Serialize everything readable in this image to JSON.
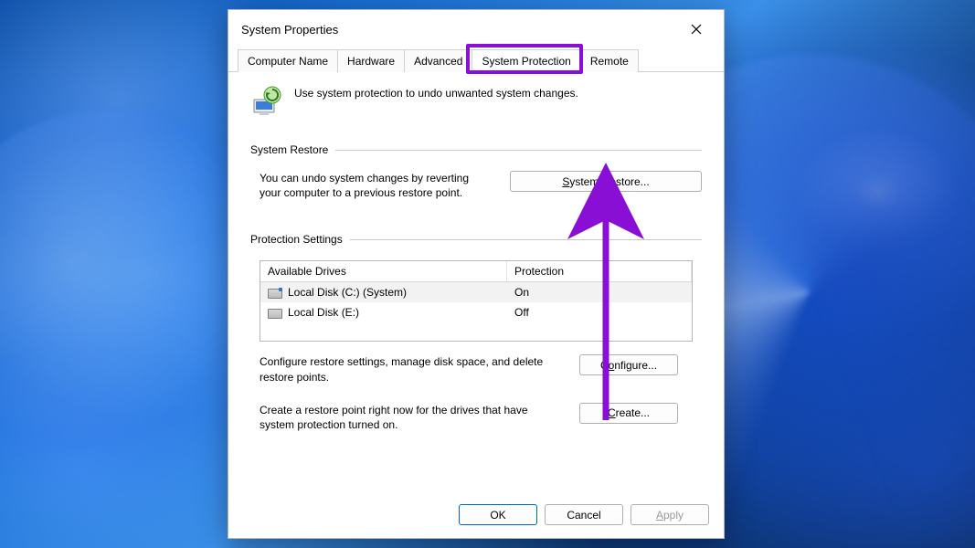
{
  "window": {
    "title": "System Properties"
  },
  "tabs": {
    "items": [
      "Computer Name",
      "Hardware",
      "Advanced",
      "System Protection",
      "Remote"
    ],
    "active_index": 3
  },
  "intro": {
    "text": "Use system protection to undo unwanted system changes."
  },
  "groups": {
    "restore": {
      "label": "System Restore",
      "text": "You can undo system changes by reverting your computer to a previous restore point.",
      "button": "System Restore..."
    },
    "protection": {
      "label": "Protection Settings",
      "table": {
        "headers": [
          "Available Drives",
          "Protection"
        ],
        "rows": [
          {
            "name": "Local Disk (C:) (System)",
            "protection": "On",
            "system": true
          },
          {
            "name": "Local Disk (E:)",
            "protection": "Off",
            "system": false
          }
        ]
      },
      "configure_text": "Configure restore settings, manage disk space, and delete restore points.",
      "configure_button": "Configure...",
      "create_text": "Create a restore point right now for the drives that have system protection turned on.",
      "create_button": "Create..."
    }
  },
  "footer": {
    "ok": "OK",
    "cancel": "Cancel",
    "apply": "Apply"
  },
  "annotations": {
    "highlight_tab": "System Protection",
    "arrow_target": "System Restore..."
  }
}
